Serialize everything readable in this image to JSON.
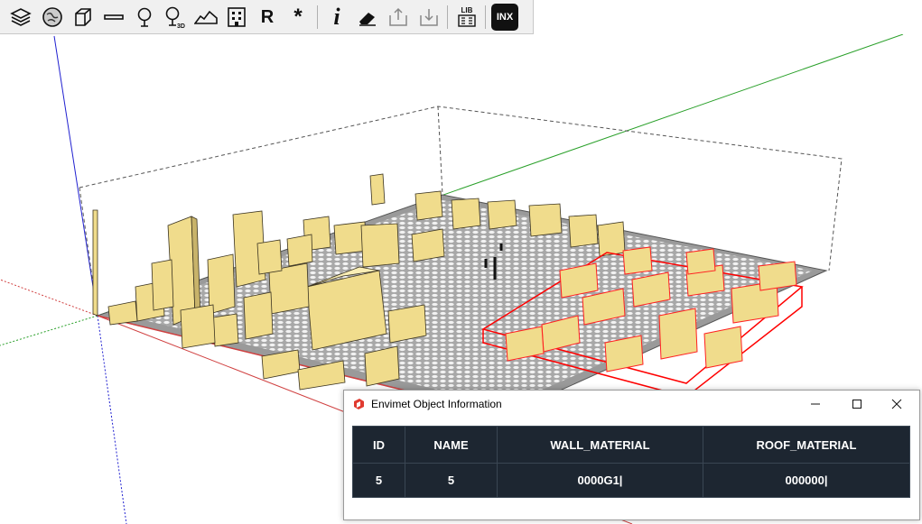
{
  "toolbar": {
    "items": [
      {
        "name": "layers-icon"
      },
      {
        "name": "globe-icon"
      },
      {
        "name": "cube-icon"
      },
      {
        "name": "line-icon"
      },
      {
        "name": "tree-icon"
      },
      {
        "name": "tree-3d-icon",
        "label": "3D"
      },
      {
        "name": "terrain-icon"
      },
      {
        "name": "building-icon"
      },
      {
        "name": "receptor-r-icon",
        "label": "R"
      },
      {
        "name": "asterisk-icon",
        "label": "*"
      },
      {
        "name": "info-icon",
        "label": "i"
      },
      {
        "name": "eraser-icon"
      },
      {
        "name": "export-icon"
      },
      {
        "name": "import-icon"
      },
      {
        "name": "library-icon",
        "label": "LIB"
      },
      {
        "name": "inx-icon",
        "label": "INX"
      }
    ]
  },
  "dialog": {
    "title": "Envimet Object Information",
    "app_icon": "sketchup-icon",
    "controls": [
      "minimize-icon",
      "maximize-icon",
      "close-icon"
    ],
    "table": {
      "headers": [
        "ID",
        "NAME",
        "WALL_MATERIAL",
        "ROOF_MATERIAL"
      ],
      "rows": [
        [
          "5",
          "5",
          "0000G1|",
          "000000|"
        ]
      ]
    }
  },
  "colors": {
    "building_fill": "#f0dc8c",
    "selection": "#ff0000",
    "axis_green": "#2aa02a",
    "axis_blue": "#2020d0",
    "axis_red": "#d04040",
    "table_bg": "#1d2631"
  }
}
